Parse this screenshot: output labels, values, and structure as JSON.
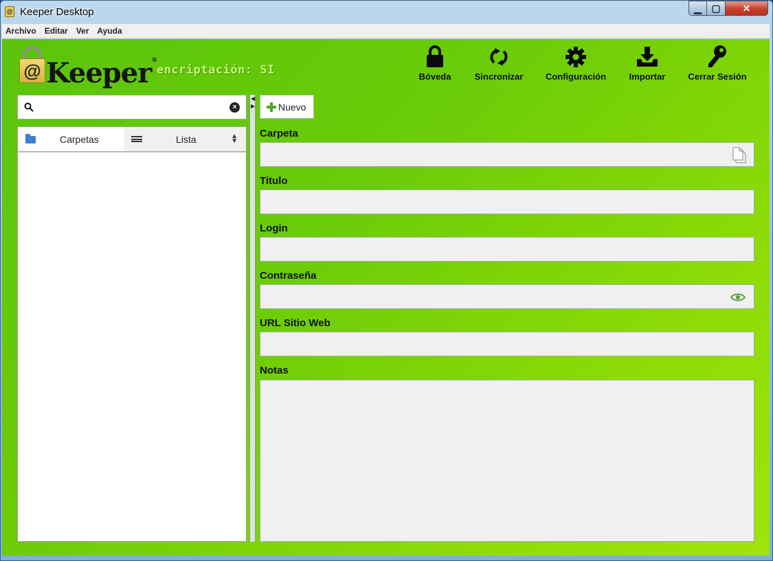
{
  "window": {
    "title": "Keeper Desktop",
    "controls": {
      "minimize": "▁",
      "maximize": "▢",
      "close": "✕"
    }
  },
  "menubar": {
    "items": [
      "Archivo",
      "Editar",
      "Ver",
      "Ayuda"
    ]
  },
  "header": {
    "logo_text": "Keeper",
    "logo_at": "@",
    "logo_reg": "®",
    "encryption_status": "encriptación: SI",
    "toolbar": [
      {
        "label": "Bóveda",
        "icon": "lock-icon"
      },
      {
        "label": "Sincronizar",
        "icon": "sync-icon"
      },
      {
        "label": "Configuración",
        "icon": "gear-icon"
      },
      {
        "label": "Importar",
        "icon": "download-icon"
      },
      {
        "label": "Cerrar Sesión",
        "icon": "key-icon"
      }
    ]
  },
  "sidebar": {
    "search": {
      "value": "",
      "placeholder": ""
    },
    "tabs": {
      "folders": "Carpetas",
      "list": "Lista"
    }
  },
  "form": {
    "new_button": "Nuevo",
    "fields": {
      "folder": {
        "label": "Carpeta",
        "value": ""
      },
      "title": {
        "label": "Titulo",
        "value": ""
      },
      "login": {
        "label": "Login",
        "value": ""
      },
      "password": {
        "label": "Contraseña",
        "value": ""
      },
      "url": {
        "label": "URL Sitio Web",
        "value": ""
      },
      "notes": {
        "label": "Notas",
        "value": ""
      }
    }
  },
  "colors": {
    "accent_green": "#6bcc08",
    "encryption_text": "#c8f27a",
    "eye_icon": "#5a9a3a"
  }
}
